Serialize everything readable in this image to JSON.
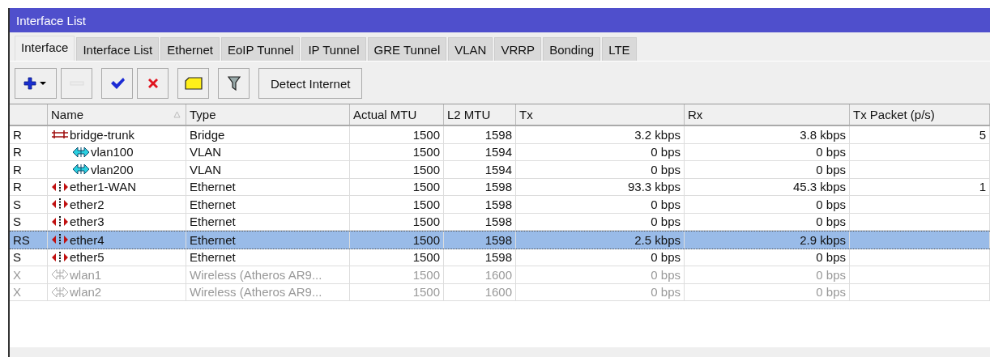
{
  "window": {
    "title": "Interface List"
  },
  "tabs": [
    {
      "label": "Interface",
      "selected": true
    },
    {
      "label": "Interface List",
      "selected": false
    },
    {
      "label": "Ethernet",
      "selected": false
    },
    {
      "label": "EoIP Tunnel",
      "selected": false
    },
    {
      "label": "IP Tunnel",
      "selected": false
    },
    {
      "label": "GRE Tunnel",
      "selected": false
    },
    {
      "label": "VLAN",
      "selected": false
    },
    {
      "label": "VRRP",
      "selected": false
    },
    {
      "label": "Bonding",
      "selected": false
    },
    {
      "label": "LTE",
      "selected": false
    }
  ],
  "toolbar": [
    {
      "kind": "add",
      "disabled": false
    },
    {
      "kind": "remove",
      "disabled": true
    },
    {
      "kind": "enable",
      "disabled": false
    },
    {
      "kind": "disable",
      "disabled": false
    },
    {
      "kind": "comment",
      "disabled": false
    },
    {
      "kind": "filter",
      "disabled": false
    },
    {
      "kind": "text",
      "label": "Detect Internet",
      "disabled": false
    }
  ],
  "table": {
    "columns": [
      "",
      "Name",
      "Type",
      "Actual MTU",
      "L2 MTU",
      "Tx",
      "Rx",
      "Tx Packet (p/s)"
    ],
    "rows": [
      {
        "status": "R",
        "kind": "bridge",
        "name": "bridge-trunk",
        "type": "Bridge",
        "actual_mtu": "1500",
        "l2_mtu": "1598",
        "tx": "3.2 kbps",
        "rx": "3.8 kbps",
        "tx_packet": "5",
        "disabled": false,
        "selected": false,
        "children": [
          {
            "status": "R",
            "kind": "vlan",
            "name": "vlan100",
            "type": "VLAN",
            "actual_mtu": "1500",
            "l2_mtu": "1594",
            "tx": "0 bps",
            "rx": "0 bps",
            "disabled": false,
            "selected": false
          },
          {
            "status": "R",
            "kind": "vlan",
            "name": "vlan200",
            "type": "VLAN",
            "actual_mtu": "1500",
            "l2_mtu": "1594",
            "tx": "0 bps",
            "rx": "0 bps",
            "disabled": false,
            "selected": false
          }
        ]
      },
      {
        "status": "R",
        "kind": "ether",
        "name": "ether1-WAN",
        "type": "Ethernet",
        "actual_mtu": "1500",
        "l2_mtu": "1598",
        "tx": "93.3 kbps",
        "rx": "45.3 kbps",
        "tx_packet": "1",
        "disabled": false,
        "selected": false
      },
      {
        "status": "S",
        "kind": "ether",
        "name": "ether2",
        "type": "Ethernet",
        "actual_mtu": "1500",
        "l2_mtu": "1598",
        "tx": "0 bps",
        "rx": "0 bps",
        "disabled": false,
        "selected": false
      },
      {
        "status": "S",
        "kind": "ether",
        "name": "ether3",
        "type": "Ethernet",
        "actual_mtu": "1500",
        "l2_mtu": "1598",
        "tx": "0 bps",
        "rx": "0 bps",
        "disabled": false,
        "selected": false
      },
      {
        "status": "RS",
        "kind": "ether",
        "name": "ether4",
        "type": "Ethernet",
        "actual_mtu": "1500",
        "l2_mtu": "1598",
        "tx": "2.5 kbps",
        "rx": "2.9 kbps",
        "disabled": false,
        "selected": true
      },
      {
        "status": "S",
        "kind": "ether",
        "name": "ether5",
        "type": "Ethernet",
        "actual_mtu": "1500",
        "l2_mtu": "1598",
        "tx": "0 bps",
        "rx": "0 bps",
        "disabled": false,
        "selected": false
      },
      {
        "status": "X",
        "kind": "wlan",
        "name": "wlan1",
        "type": "Wireless (Atheros AR9...",
        "actual_mtu": "1500",
        "l2_mtu": "1600",
        "tx": "0 bps",
        "rx": "0 bps",
        "disabled": true,
        "selected": false
      },
      {
        "status": "X",
        "kind": "wlan",
        "name": "wlan2",
        "type": "Wireless (Atheros AR9...",
        "actual_mtu": "1500",
        "l2_mtu": "1600",
        "tx": "0 bps",
        "rx": "0 bps",
        "disabled": true,
        "selected": false
      }
    ]
  }
}
